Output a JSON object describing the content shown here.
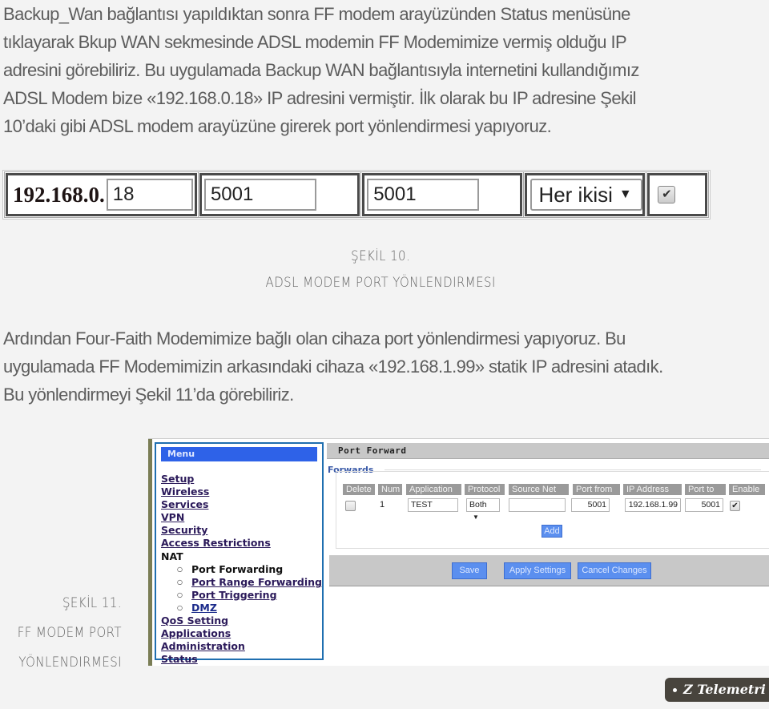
{
  "paragraph1": {
    "lines": [
      "Backup_Wan bağlantısı yapıldıktan sonra FF modem arayüzünden Status menüsüne",
      "tıklayarak Bkup WAN sekmesinde ADSL modemin FF Modemimize vermiş olduğu IP",
      "adresini görebiliriz. Bu uygulamada Backup WAN bağlantısıyla internetini kullandığımız",
      "ADSL Modem bize «192.168.0.18» IP adresini vermiştir. İlk olarak bu IP adresine Şekil",
      "10’daki gibi ADSL modem arayüzüne girerek port yönlendirmesi yapıyoruz."
    ]
  },
  "figure10": {
    "ip_prefix": "192.168.0.",
    "ip_last_octet": "18",
    "port_start": "5001",
    "port_end": "5001",
    "protocol": "Her ikisi",
    "enabled": true,
    "caption_number": "ŞEKİL 10.",
    "caption_title": "ADSL MODEM PORT YÖNLENDIRMESI"
  },
  "paragraph2": {
    "lines": [
      "Ardından Four-Faith Modemimize bağlı olan cihaza port yönlendirmesi yapıyoruz. Bu",
      "uygulamada FF Modemimizin arkasındaki cihaza «192.168.1.99» statik IP adresini atadık.",
      "Bu yönlendirmeyi Şekil 11’da görebiliriz."
    ]
  },
  "figure11": {
    "caption_lines": [
      "ŞEKİL 11.",
      "FF MODEM PORT",
      "YÖNLENDIRMESI"
    ],
    "menu": {
      "title": "Menu",
      "items": [
        {
          "label": "Setup",
          "link": true
        },
        {
          "label": "Wireless",
          "link": true
        },
        {
          "label": "Services",
          "link": true
        },
        {
          "label": "VPN",
          "link": true
        },
        {
          "label": "Security",
          "link": true
        },
        {
          "label": "Access Restrictions",
          "link": true
        },
        {
          "label": "NAT",
          "link": false
        },
        {
          "label": "Port Forwarding",
          "link": false,
          "sub": true
        },
        {
          "label": "Port Range Forwarding",
          "link": true,
          "sub": true
        },
        {
          "label": "Port Triggering",
          "link": true,
          "sub": true
        },
        {
          "label": "DMZ",
          "link": true,
          "sub": true
        },
        {
          "label": "QoS Setting",
          "link": true
        },
        {
          "label": "Applications",
          "link": true
        },
        {
          "label": "Administration",
          "link": true
        },
        {
          "label": "Status",
          "link": true
        }
      ]
    },
    "panel_title": "Port Forward",
    "section_title": "Forwards",
    "columns": [
      "Delete",
      "Num",
      "Application",
      "Protocol",
      "Source Net",
      "Port from",
      "IP Address",
      "Port to",
      "Enable"
    ],
    "row": {
      "delete": false,
      "num": "1",
      "application": "TEST",
      "protocol": "Both",
      "source_net": "",
      "port_from": "5001",
      "ip_address": "192.168.1.99",
      "port_to": "5001",
      "enable": true
    },
    "add_label": "Add",
    "save_label": "Save",
    "apply_label": "Apply Settings",
    "cancel_label": "Cancel Changes"
  },
  "logo": {
    "text": "Z Telemetri"
  },
  "colors": {
    "menu_title_bg": "#2e62e8",
    "button_bg": "#5b8fef",
    "header_gray": "#c8c8c8",
    "logo_bg": "#48443d"
  }
}
